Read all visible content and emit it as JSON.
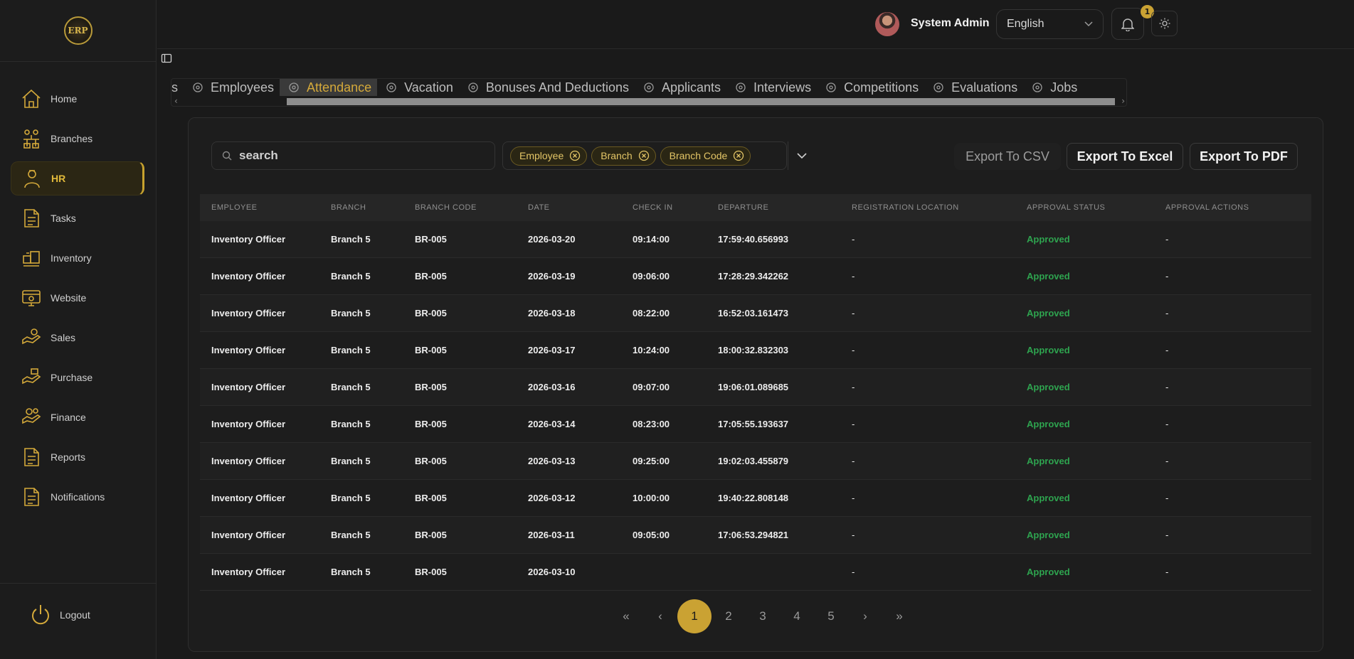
{
  "app": {
    "logo_text": "ERP"
  },
  "sidebar": {
    "items": [
      {
        "label": "Home",
        "icon": "home-icon"
      },
      {
        "label": "Branches",
        "icon": "branches-icon"
      },
      {
        "label": "HR",
        "icon": "hr-icon",
        "active": true
      },
      {
        "label": "Tasks",
        "icon": "document-icon"
      },
      {
        "label": "Inventory",
        "icon": "inventory-icon"
      },
      {
        "label": "Website",
        "icon": "website-icon"
      },
      {
        "label": "Sales",
        "icon": "sales-icon"
      },
      {
        "label": "Purchase",
        "icon": "purchase-icon"
      },
      {
        "label": "Finance",
        "icon": "finance-icon"
      },
      {
        "label": "Reports",
        "icon": "document-icon"
      },
      {
        "label": "Notifications",
        "icon": "document-icon"
      }
    ],
    "logout_label": "Logout"
  },
  "topbar": {
    "user_name": "System Admin",
    "language": "English",
    "notification_count": "1"
  },
  "tabs": {
    "partial_label": "s",
    "items": [
      "Employees",
      "Attendance",
      "Vacation",
      "Bonuses And Deductions",
      "Applicants",
      "Interviews",
      "Competitions",
      "Evaluations",
      "Jobs"
    ],
    "active": "Attendance"
  },
  "toolbar": {
    "search_placeholder": "search",
    "filters": [
      "Employee",
      "Branch",
      "Branch Code"
    ],
    "export_csv": "Export To CSV",
    "export_excel": "Export To Excel",
    "export_pdf": "Export To PDF"
  },
  "table": {
    "columns": [
      "EMPLOYEE",
      "BRANCH",
      "BRANCH CODE",
      "DATE",
      "CHECK IN",
      "DEPARTURE",
      "REGISTRATION LOCATION",
      "APPROVAL STATUS",
      "APPROVAL ACTIONS"
    ],
    "rows": [
      [
        "Inventory Officer",
        "Branch 5",
        "BR-005",
        "2026-03-20",
        "09:14:00",
        "17:59:40.656993",
        "-",
        "Approved",
        "-"
      ],
      [
        "Inventory Officer",
        "Branch 5",
        "BR-005",
        "2026-03-19",
        "09:06:00",
        "17:28:29.342262",
        "-",
        "Approved",
        "-"
      ],
      [
        "Inventory Officer",
        "Branch 5",
        "BR-005",
        "2026-03-18",
        "08:22:00",
        "16:52:03.161473",
        "-",
        "Approved",
        "-"
      ],
      [
        "Inventory Officer",
        "Branch 5",
        "BR-005",
        "2026-03-17",
        "10:24:00",
        "18:00:32.832303",
        "-",
        "Approved",
        "-"
      ],
      [
        "Inventory Officer",
        "Branch 5",
        "BR-005",
        "2026-03-16",
        "09:07:00",
        "19:06:01.089685",
        "-",
        "Approved",
        "-"
      ],
      [
        "Inventory Officer",
        "Branch 5",
        "BR-005",
        "2026-03-14",
        "08:23:00",
        "17:05:55.193637",
        "-",
        "Approved",
        "-"
      ],
      [
        "Inventory Officer",
        "Branch 5",
        "BR-005",
        "2026-03-13",
        "09:25:00",
        "19:02:03.455879",
        "-",
        "Approved",
        "-"
      ],
      [
        "Inventory Officer",
        "Branch 5",
        "BR-005",
        "2026-03-12",
        "10:00:00",
        "19:40:22.808148",
        "-",
        "Approved",
        "-"
      ],
      [
        "Inventory Officer",
        "Branch 5",
        "BR-005",
        "2026-03-11",
        "09:05:00",
        "17:06:53.294821",
        "-",
        "Approved",
        "-"
      ],
      [
        "Inventory Officer",
        "Branch 5",
        "BR-005",
        "2026-03-10",
        "",
        "",
        "-",
        "Approved",
        "-"
      ]
    ]
  },
  "pagination": {
    "first": "«",
    "prev": "‹",
    "pages": [
      "1",
      "2",
      "3",
      "4",
      "5"
    ],
    "current": "1",
    "next": "›",
    "last": "»"
  },
  "colors": {
    "accent": "#caa233",
    "approved": "#2ea44f",
    "background": "#1a1a1a"
  }
}
